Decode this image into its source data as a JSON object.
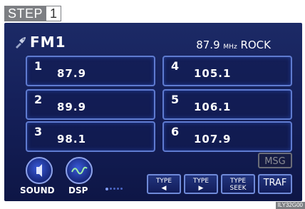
{
  "step": {
    "label": "STEP",
    "number": "1"
  },
  "header": {
    "band": "FM1",
    "frequency": "87.9",
    "unit": "MHz",
    "genre": "ROCK"
  },
  "presets": [
    {
      "num": "1",
      "freq": "87.9"
    },
    {
      "num": "2",
      "freq": "89.9"
    },
    {
      "num": "3",
      "freq": "98.1"
    },
    {
      "num": "4",
      "freq": "105.1"
    },
    {
      "num": "5",
      "freq": "106.1"
    },
    {
      "num": "6",
      "freq": "107.9"
    }
  ],
  "controls": {
    "sound": "SOUND",
    "dsp": "DSP",
    "msg": "MSG",
    "type_prev": {
      "line1": "TYPE",
      "arrow": "◀"
    },
    "type_next": {
      "line1": "TYPE",
      "arrow": "▶"
    },
    "type_seek": {
      "line1": "TYPE",
      "line2": "SEEK"
    },
    "traf": "TRAF"
  },
  "figure_code": "ILY32G00",
  "colors": {
    "screen_bg": "#15205a",
    "button_border": "#5f7bd0",
    "step_bg": "#7d7f83"
  }
}
